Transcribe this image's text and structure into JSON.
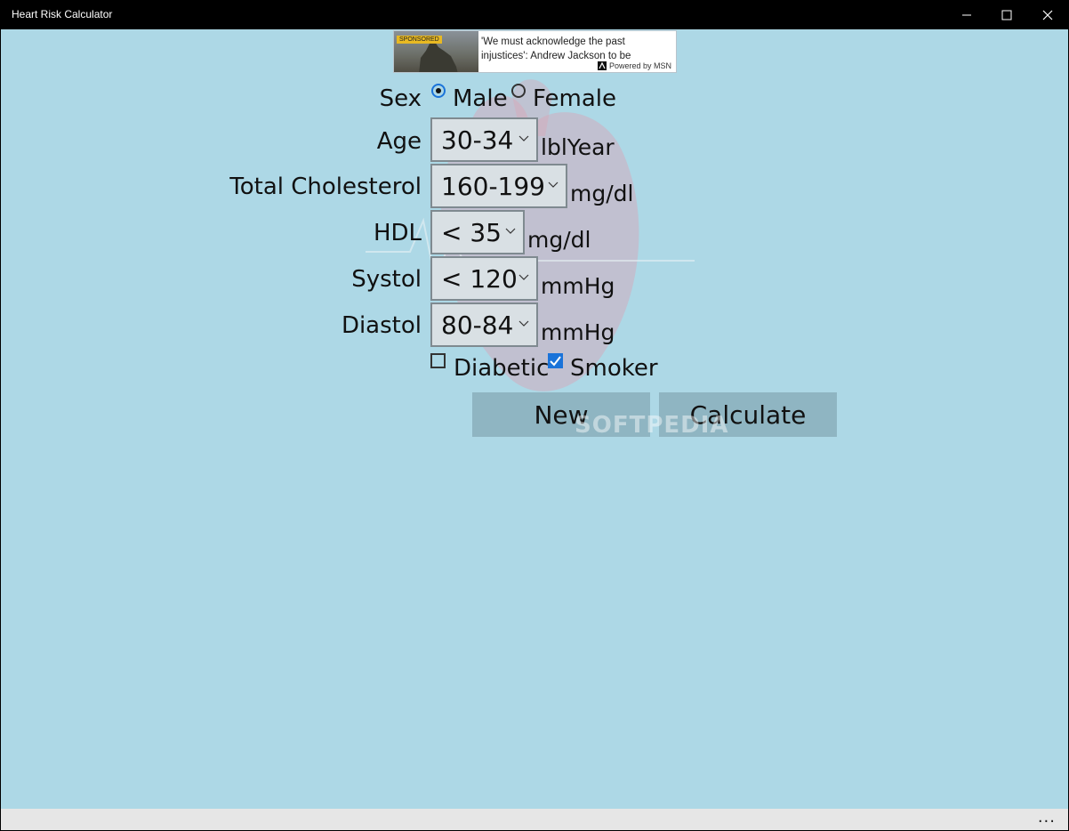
{
  "window": {
    "title": "Heart Risk Calculator"
  },
  "ad": {
    "badge": "SPONSORED",
    "headline": "'We must acknowledge the past injustices': Andrew Jackson to be",
    "powered": "Powered by MSN"
  },
  "form": {
    "sex": {
      "label": "Sex",
      "options": [
        "Male",
        "Female"
      ],
      "selected": "Male"
    },
    "age": {
      "label": "Age",
      "value": "30-34",
      "unit": "lblYear"
    },
    "cholesterol": {
      "label": "Total Cholesterol",
      "value": "160-199",
      "unit": "mg/dl"
    },
    "hdl": {
      "label": "HDL",
      "value": "< 35",
      "unit": "mg/dl"
    },
    "systol": {
      "label": "Systol",
      "value": "< 120",
      "unit": "mmHg"
    },
    "diastol": {
      "label": "Diastol",
      "value": "80-84",
      "unit": "mmHg"
    },
    "diabetic": {
      "label": "Diabetic",
      "checked": false
    },
    "smoker": {
      "label": "Smoker",
      "checked": true
    }
  },
  "buttons": {
    "new": "New",
    "calculate": "Calculate"
  },
  "watermark": "SOFTPEDIA",
  "appbar": {
    "more": "..."
  },
  "colors": {
    "background": "#add8e6",
    "accent": "#1a73d9",
    "button": "#8fb5c2"
  }
}
